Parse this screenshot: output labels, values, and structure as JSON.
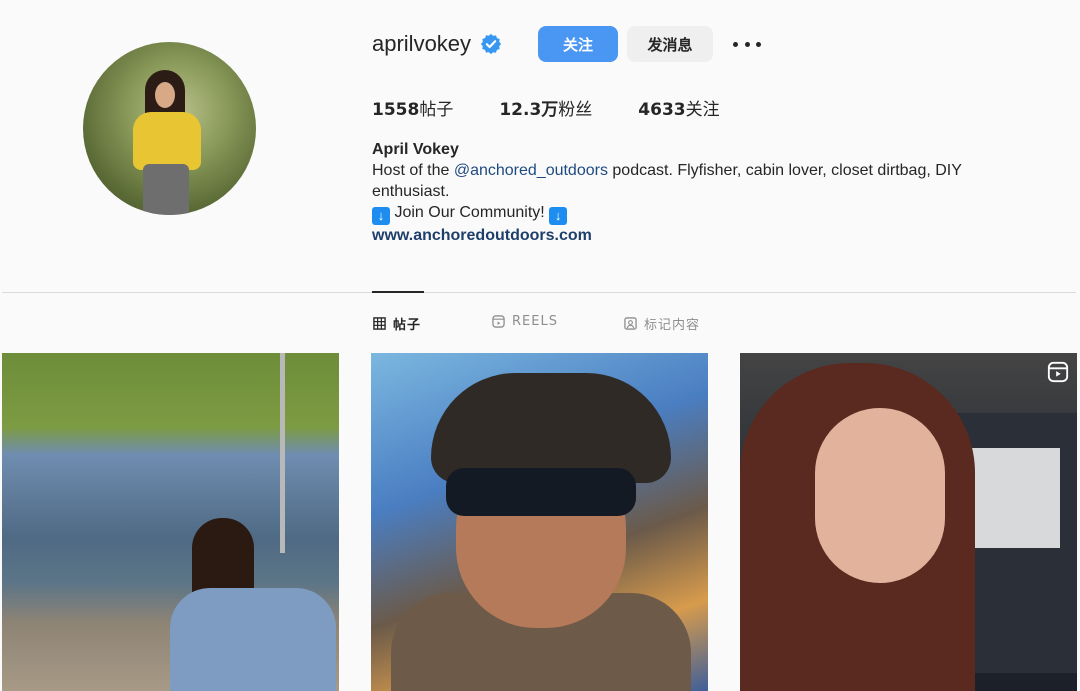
{
  "profile": {
    "username": "aprilvokey",
    "follow_label": "关注",
    "message_label": "发消息",
    "stats": [
      {
        "count": "1558",
        "label": "帖子"
      },
      {
        "count": "12.3万",
        "label": "粉丝"
      },
      {
        "count": "4633",
        "label": "关注"
      }
    ],
    "full_name": "April Vokey",
    "bio_prefix": "Host of the ",
    "bio_mention": "@anchored_outdoors",
    "bio_suffix": " podcast. Flyfisher, cabin lover, closet dirtbag, DIY enthusiast.",
    "community_text": " Join Our Community! ",
    "website": "www.anchoredoutdoors.com"
  },
  "tabs": [
    {
      "label": "帖子",
      "icon": "grid-icon"
    },
    {
      "label": "REELS",
      "icon": "reels-icon"
    },
    {
      "label": "标记内容",
      "icon": "tagged-icon"
    }
  ],
  "colors": {
    "accent": "#4a96f3",
    "link": "#1f3f6b",
    "text": "#262626",
    "muted": "#8e8e8e"
  }
}
